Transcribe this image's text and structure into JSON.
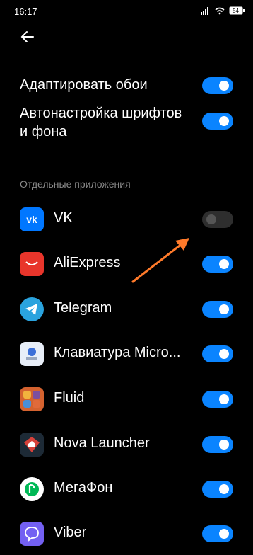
{
  "status": {
    "time": "16:17",
    "battery": "54"
  },
  "settings": [
    {
      "label": "Адаптировать обои",
      "enabled": true
    },
    {
      "label": "Автонастройка шрифтов\nи фона",
      "enabled": true
    }
  ],
  "section_header": "Отдельные приложения",
  "apps": [
    {
      "name": "VK",
      "enabled": false,
      "icon": "vk-icon",
      "color": "#0077ff"
    },
    {
      "name": "AliExpress",
      "enabled": true,
      "icon": "aliexpress-icon",
      "color": "#e8352b"
    },
    {
      "name": "Telegram",
      "enabled": true,
      "icon": "telegram-icon",
      "color": "#2aa3de"
    },
    {
      "name": "Клавиатура Micro...",
      "enabled": true,
      "icon": "swiftkey-keyboard-icon",
      "color": "#e8eef8"
    },
    {
      "name": "Fluid",
      "enabled": true,
      "icon": "fluid-icon",
      "color": "#d4622f"
    },
    {
      "name": "Nova Launcher",
      "enabled": true,
      "icon": "nova-launcher-icon",
      "color": "#1d2a36"
    },
    {
      "name": "МегаФон",
      "enabled": true,
      "icon": "megafon-icon",
      "color": "#ffffff"
    },
    {
      "name": "Viber",
      "enabled": true,
      "icon": "viber-icon",
      "color": "#7360f2"
    }
  ],
  "colors": {
    "toggle_on": "#0a84ff",
    "toggle_off": "#2e2e2e",
    "annotation_arrow": "#ff7a2a"
  }
}
